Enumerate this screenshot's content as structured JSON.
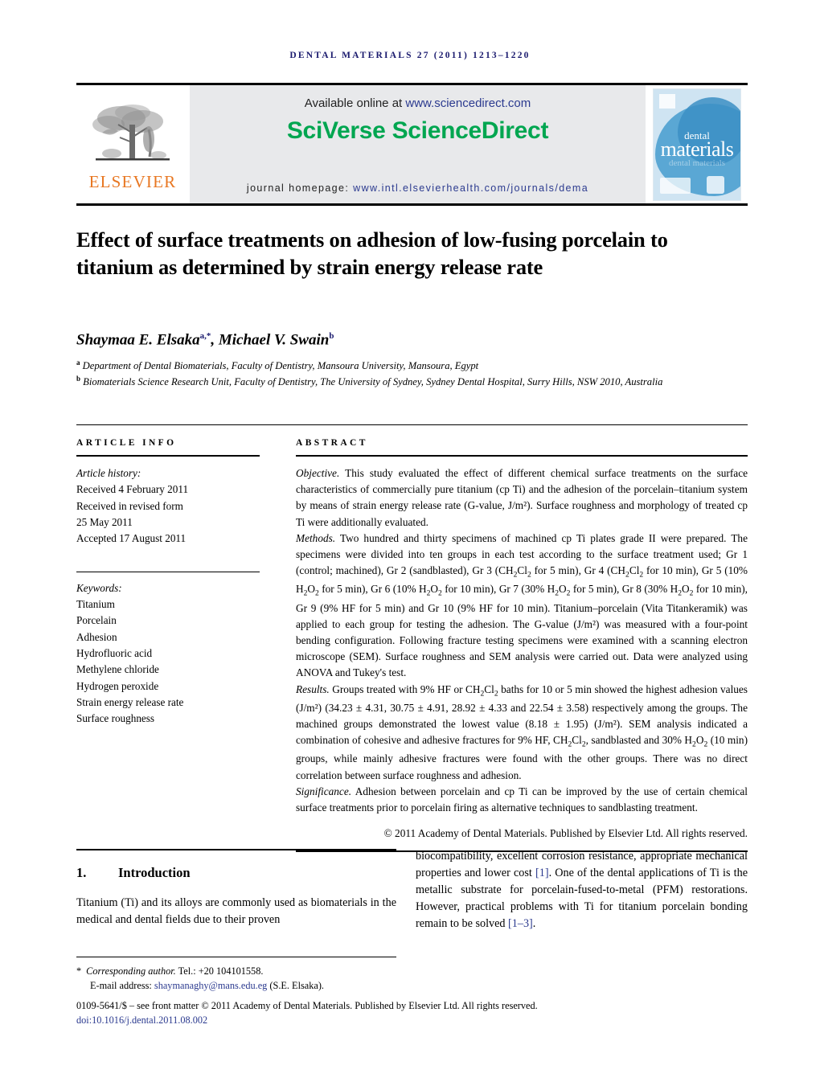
{
  "running_head": "Dental Materials 27 (2011) 1213–1220",
  "masthead": {
    "publisher_name": "ELSEVIER",
    "available_prefix": "Available online at ",
    "available_url": "www.sciencedirect.com",
    "platform": "SciVerse ScienceDirect",
    "homepage_label": "journal homepage: ",
    "homepage_url": "www.intl.elsevierhealth.com/journals/dema",
    "cover": {
      "line1": "dental",
      "line2": "materials",
      "ghost": "dental materials"
    }
  },
  "article": {
    "title": "Effect of surface treatments on adhesion of low-fusing porcelain to titanium as determined by strain energy release rate",
    "authors_html": "Shaymaa E. Elsaka<sup>a,</sup><sup>*</sup>, Michael V. Swain<sup>b</sup>",
    "affiliation_a": "Department of Dental Biomaterials, Faculty of Dentistry, Mansoura University, Mansoura, Egypt",
    "affiliation_b": "Biomaterials Science Research Unit, Faculty of Dentistry, The University of Sydney, Sydney Dental Hospital, Surry Hills, NSW 2010, Australia"
  },
  "info": {
    "heading": "ARTICLE INFO",
    "history_label": "Article history:",
    "history": [
      "Received 4 February 2011",
      "Received in revised form",
      "25 May 2011",
      "Accepted 17 August 2011"
    ],
    "keywords_label": "Keywords:",
    "keywords": [
      "Titanium",
      "Porcelain",
      "Adhesion",
      "Hydrofluoric acid",
      "Methylene chloride",
      "Hydrogen peroxide",
      "Strain energy release rate",
      "Surface roughness"
    ]
  },
  "abstract": {
    "heading": "ABSTRACT",
    "objective_label": "Objective.",
    "objective_text": " This study evaluated the effect of different chemical surface treatments on the surface characteristics of commercially pure titanium (cp Ti) and the adhesion of the porcelain–titanium system by means of strain energy release rate (G-value, J/m²). Surface roughness and morphology of treated cp Ti were additionally evaluated.",
    "methods_label": "Methods.",
    "methods_text_1": " Two hundred and thirty specimens of machined cp Ti plates grade II were prepared. The specimens were divided into ten groups in each test according to the surface treatment used; Gr 1 (control; machined), Gr 2 (sandblasted), Gr 3 (CH",
    "methods_text_2": " for 5 min), Gr 4 (CH",
    "methods_text_3": " for 10 min), Gr 5 (10% H",
    "methods_text_4": " for 5 min), Gr 6 (10% H",
    "methods_text_5": " for 10 min), Gr 7 (30% H",
    "methods_text_6": " for 5 min), Gr 8 (30% H",
    "methods_text_7": " for 10 min), Gr 9 (9% HF for 5 min) and Gr 10 (9% HF for 10 min). Titanium–porcelain (Vita Titankeramik) was applied to each group for testing the adhesion. The G-value (J/m²) was measured with a four-point bending configuration. Following fracture testing specimens were examined with a scanning electron microscope (SEM). Surface roughness and SEM analysis were carried out. Data were analyzed using ANOVA and Tukey's test.",
    "results_label": "Results.",
    "results_text_1": " Groups treated with 9% HF or CH",
    "results_text_2": " baths for 10 or 5 min showed the highest adhesion values (J/m²) (34.23 ± 4.31, 30.75 ± 4.91, 28.92 ± 4.33 and 22.54 ± 3.58) respectively among the groups. The machined groups demonstrated the lowest value (8.18 ± 1.95) (J/m²). SEM analysis indicated a combination of cohesive and adhesive fractures for 9% HF, CH",
    "results_text_3": ", sandblasted and 30% H",
    "results_text_4": " (10 min) groups, while mainly adhesive fractures were found with the other groups. There was no direct correlation between surface roughness and adhesion.",
    "significance_label": "Significance.",
    "significance_text": " Adhesion between porcelain and cp Ti can be improved by the use of certain chemical surface treatments prior to porcelain firing as alternative techniques to sandblasting treatment.",
    "copyright": "© 2011 Academy of Dental Materials. Published by Elsevier Ltd. All rights reserved."
  },
  "body": {
    "section_number": "1.",
    "section_title": "Introduction",
    "left_paragraph": "Titanium (Ti) and its alloys are commonly used as biomaterials in the medical and dental fields due to their proven",
    "right_paragraph_1": "biocompatibility, excellent corrosion resistance, appropriate mechanical properties and lower cost ",
    "right_ref_1": "[1]",
    "right_paragraph_2": ". One of the dental applications of Ti is the metallic substrate for porcelain-fused-to-metal (PFM) restorations. However, practical problems with Ti for titanium porcelain bonding remain to be solved ",
    "right_ref_2": "[1–3]",
    "right_paragraph_3": "."
  },
  "footnote": {
    "marker": "*",
    "corresponding_label": "Corresponding author.",
    "tel": " Tel.: +20 104101558.",
    "email_label": "E-mail address: ",
    "email": "shaymanaghy@mans.edu.eg",
    "email_suffix": " (S.E. Elsaka)."
  },
  "footer": {
    "front_matter": "0109-5641/$ – see front matter © 2011 Academy of Dental Materials. Published by Elsevier Ltd. All rights reserved.",
    "doi_label": "doi:",
    "doi": "10.1016/j.dental.2011.08.002"
  },
  "colors": {
    "running_head": "#1a1a6e",
    "sciverse_green": "#00a650",
    "elsevier_orange": "#E87722",
    "link_blue": "#2b3a8f",
    "masthead_grey": "#e8e9eb"
  }
}
